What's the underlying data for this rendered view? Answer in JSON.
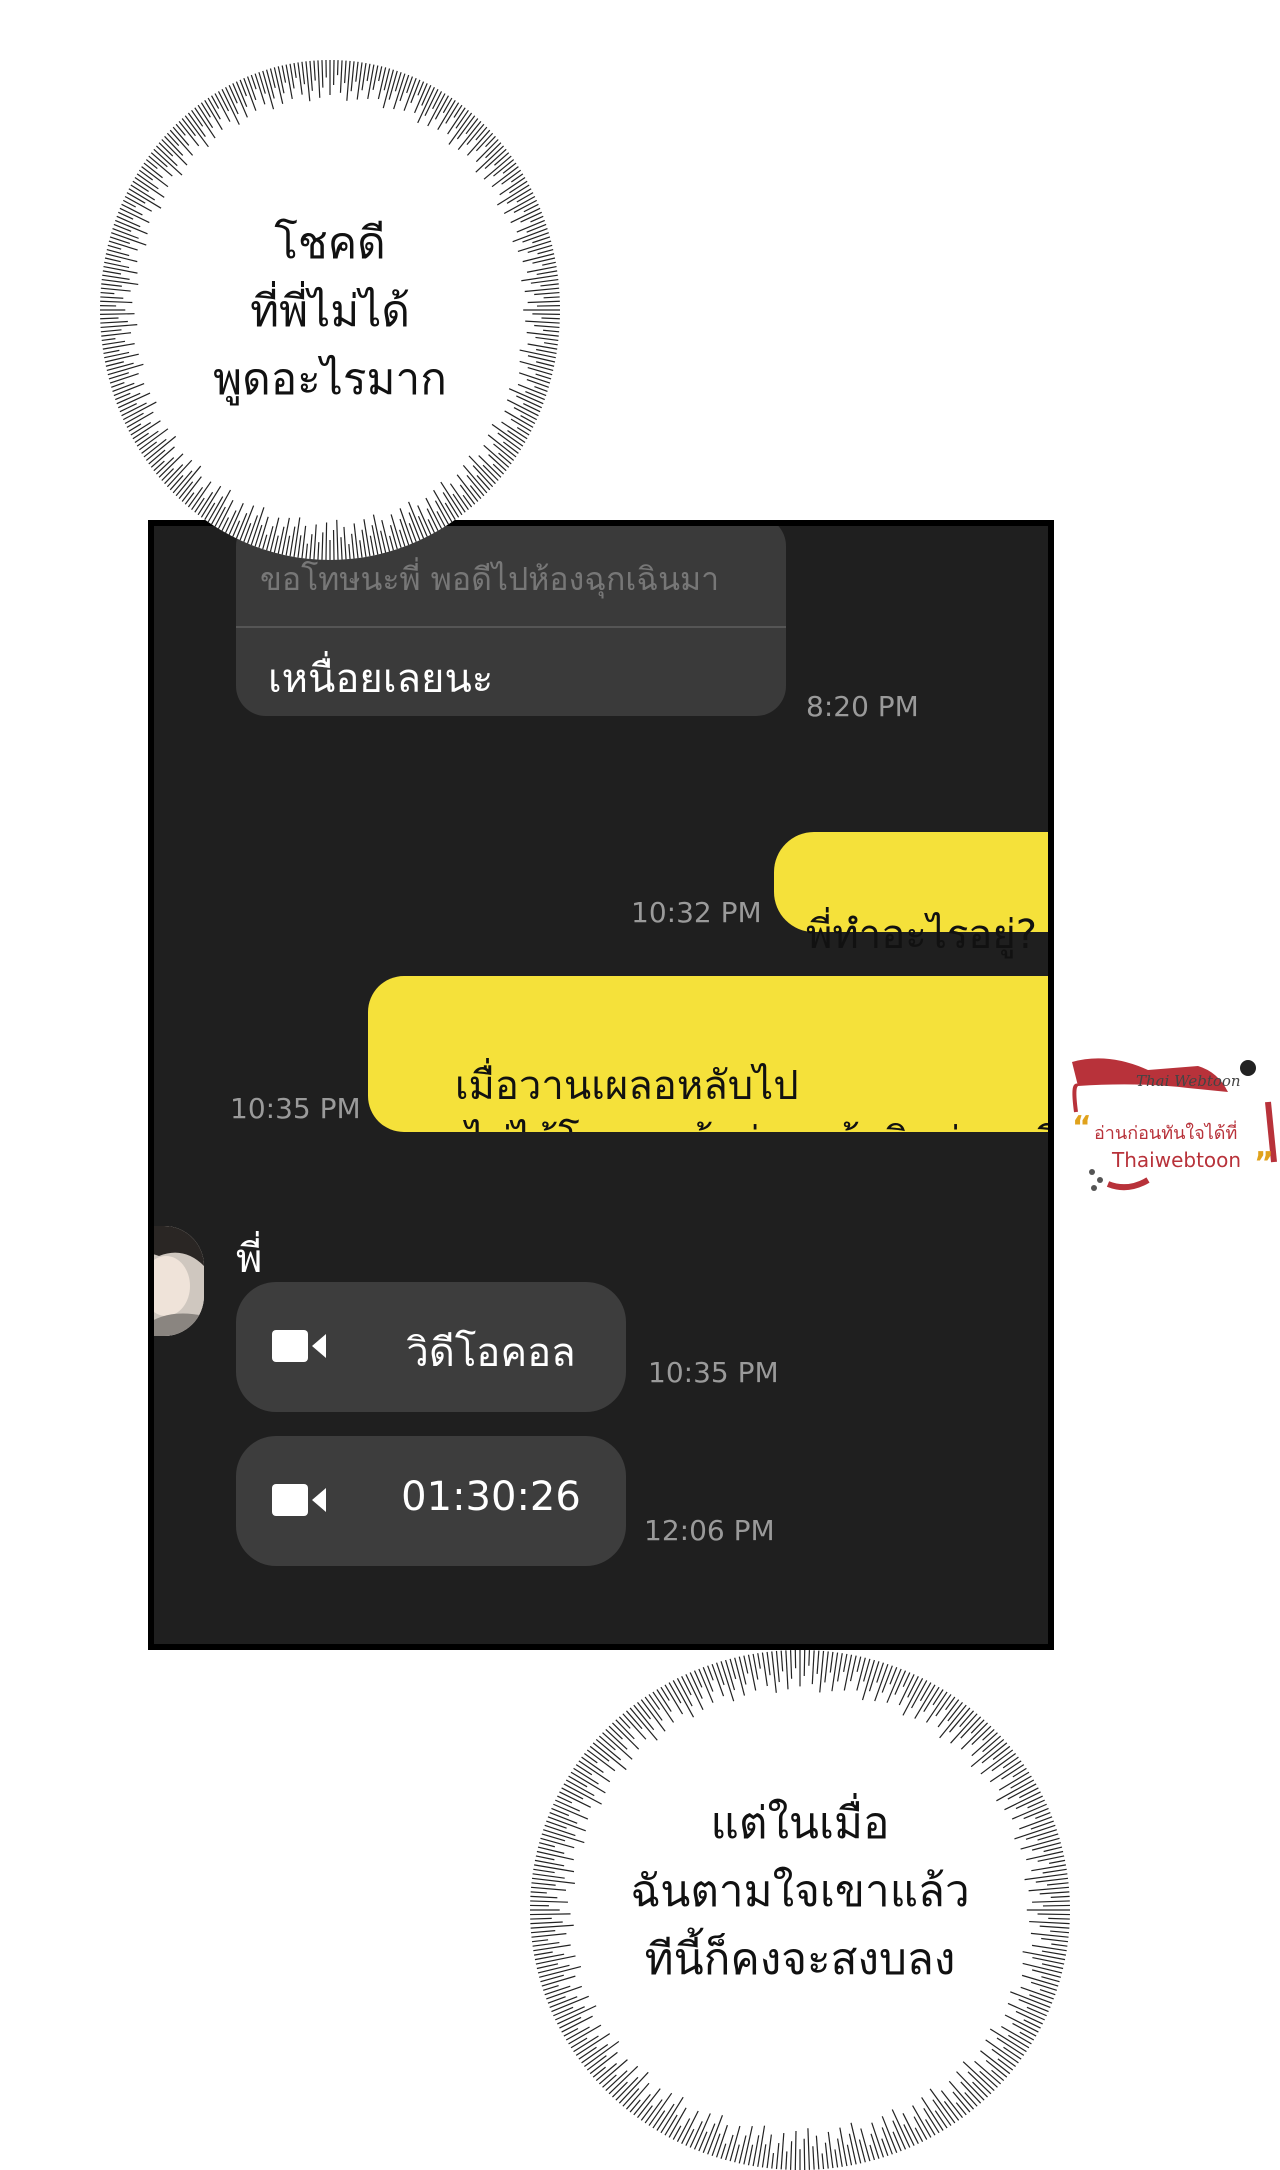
{
  "thoughts": [
    {
      "id": "top",
      "text": "โชคดี\nที่พี่ไม่ได้\nพูดอะไรมาก"
    },
    {
      "id": "bottom",
      "text": "แต่ในเมื่อ\nฉันตามใจเขาแล้ว\nทีนี้ก็คงจะสงบลง"
    }
  ],
  "chat": {
    "reply_quote": "ขอโทษนะพี่ พอดีไปห้องฉุกเฉินมา",
    "reply_message": "เหนื่อยเลยนะ",
    "reply_time": "8:20 PM",
    "outgoing": [
      {
        "text": "พี่ทำอะไรอยู่?",
        "time": "10:32 PM"
      },
      {
        "text": "เมื่อวานเผลอหลับไป\nเลยไม่ได้โทรหา ถ้าอ่านแล้วติดต่อมาที",
        "time": "10:35 PM"
      }
    ],
    "sender_name": "พี่",
    "calls": [
      {
        "label": "วิดีโอคอล",
        "time": "10:35 PM",
        "icon": "video-camera-icon"
      },
      {
        "label": "01:30:26",
        "time": "12:06 PM",
        "icon": "video-camera-icon"
      }
    ]
  },
  "watermark": {
    "logo": "Thai Webtoon",
    "line1": "อ่านก่อนทันใจได้ที่",
    "line2": "Thaiwebtoon"
  },
  "colors": {
    "chat_bg": "#1f1f1f",
    "yellow_bubble": "#f5e13a",
    "gray_bubble": "#3a3a3a",
    "timestamp": "#9a9a9a",
    "watermark_red": "#b8323a"
  }
}
